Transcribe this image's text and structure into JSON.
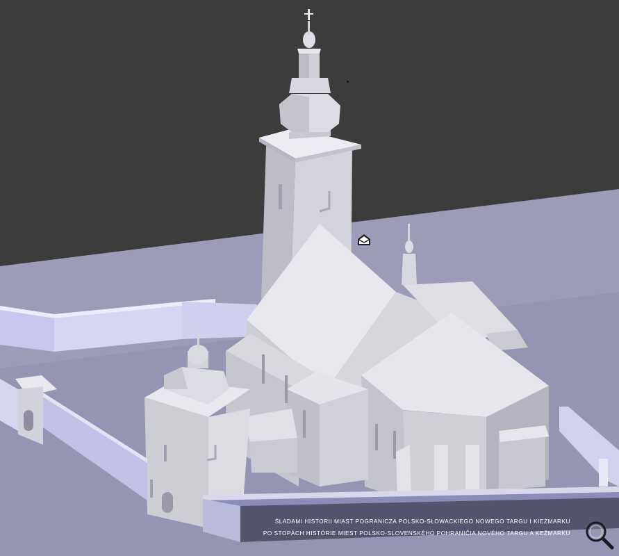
{
  "caption": {
    "line1": "ŚLADAMI HISTORII MIAST POGRANICZA POLSKO-SŁOWACKIEGO NOWEGO TARGU I KIEŻMARKU",
    "line2": "PO STOPÁCH HISTÓRIE MIEST POLSKO-SLOVENSKÉHO POHRANIČIA NOVÉHO TARGU A KEŽMARKU"
  },
  "icons": {
    "zoom": "magnifier-icon",
    "mail": "envelope-icon"
  },
  "colors": {
    "background": "#3c3c3c",
    "ground": "#9d9cb8",
    "model_light": "#e6e6ea",
    "model_mid": "#cfcfd6",
    "model_shadow": "#a4a4b2",
    "wall_lavender": "#c9c9ef"
  }
}
